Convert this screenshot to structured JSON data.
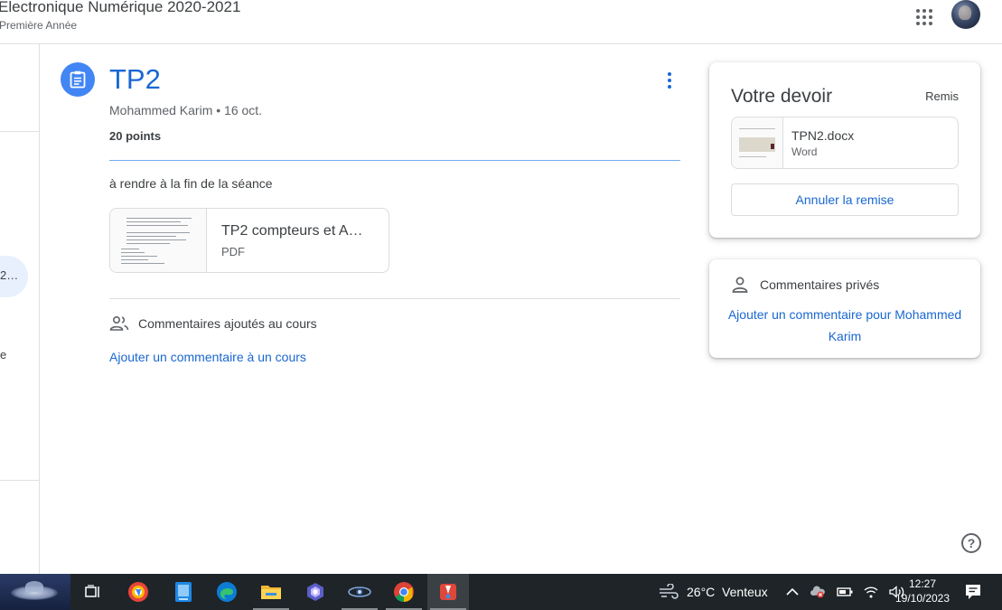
{
  "header": {
    "course_title": "Electronique Numérique 2020-2021",
    "course_subtitle": "Première Année",
    "apps_icon": "apps-grid-icon",
    "avatar_icon": "account-avatar"
  },
  "left_nav": {
    "active_item_label": "2…",
    "item_label_e": "e"
  },
  "assignment": {
    "icon": "assignment-icon",
    "title": "TP2",
    "meta": "Mohammed Karim • 16 oct.",
    "points": "20 points",
    "instructions": "à rendre à la fin de la séance",
    "attachment": {
      "name": "TP2 compteurs et A…",
      "type": "PDF"
    }
  },
  "class_comments": {
    "heading": "Commentaires ajoutés au cours",
    "add_link": "Ajouter un commentaire à un cours"
  },
  "your_work": {
    "heading": "Votre devoir",
    "status": "Remis",
    "file": {
      "name": "TPN2.docx",
      "type": "Word"
    },
    "unsubmit_label": "Annuler la remise"
  },
  "private_comments": {
    "heading": "Commentaires privés",
    "add_link": "Ajouter un commentaire pour Mohammed Karim"
  },
  "help_label": "?",
  "taskbar": {
    "weather": "26°C  Venteux",
    "time": "12:27",
    "date": "19/10/2023",
    "apps": [
      "start-button",
      "task-view-icon",
      "browser-icon",
      "file-icon",
      "edge-icon",
      "folder-icon",
      "copilot-icon",
      "app-icon",
      "chrome-icon",
      "snip-icon"
    ]
  },
  "colors": {
    "accent": "#1967d2",
    "icon_blue": "#4285f4",
    "taskbar": "#1f2428"
  }
}
